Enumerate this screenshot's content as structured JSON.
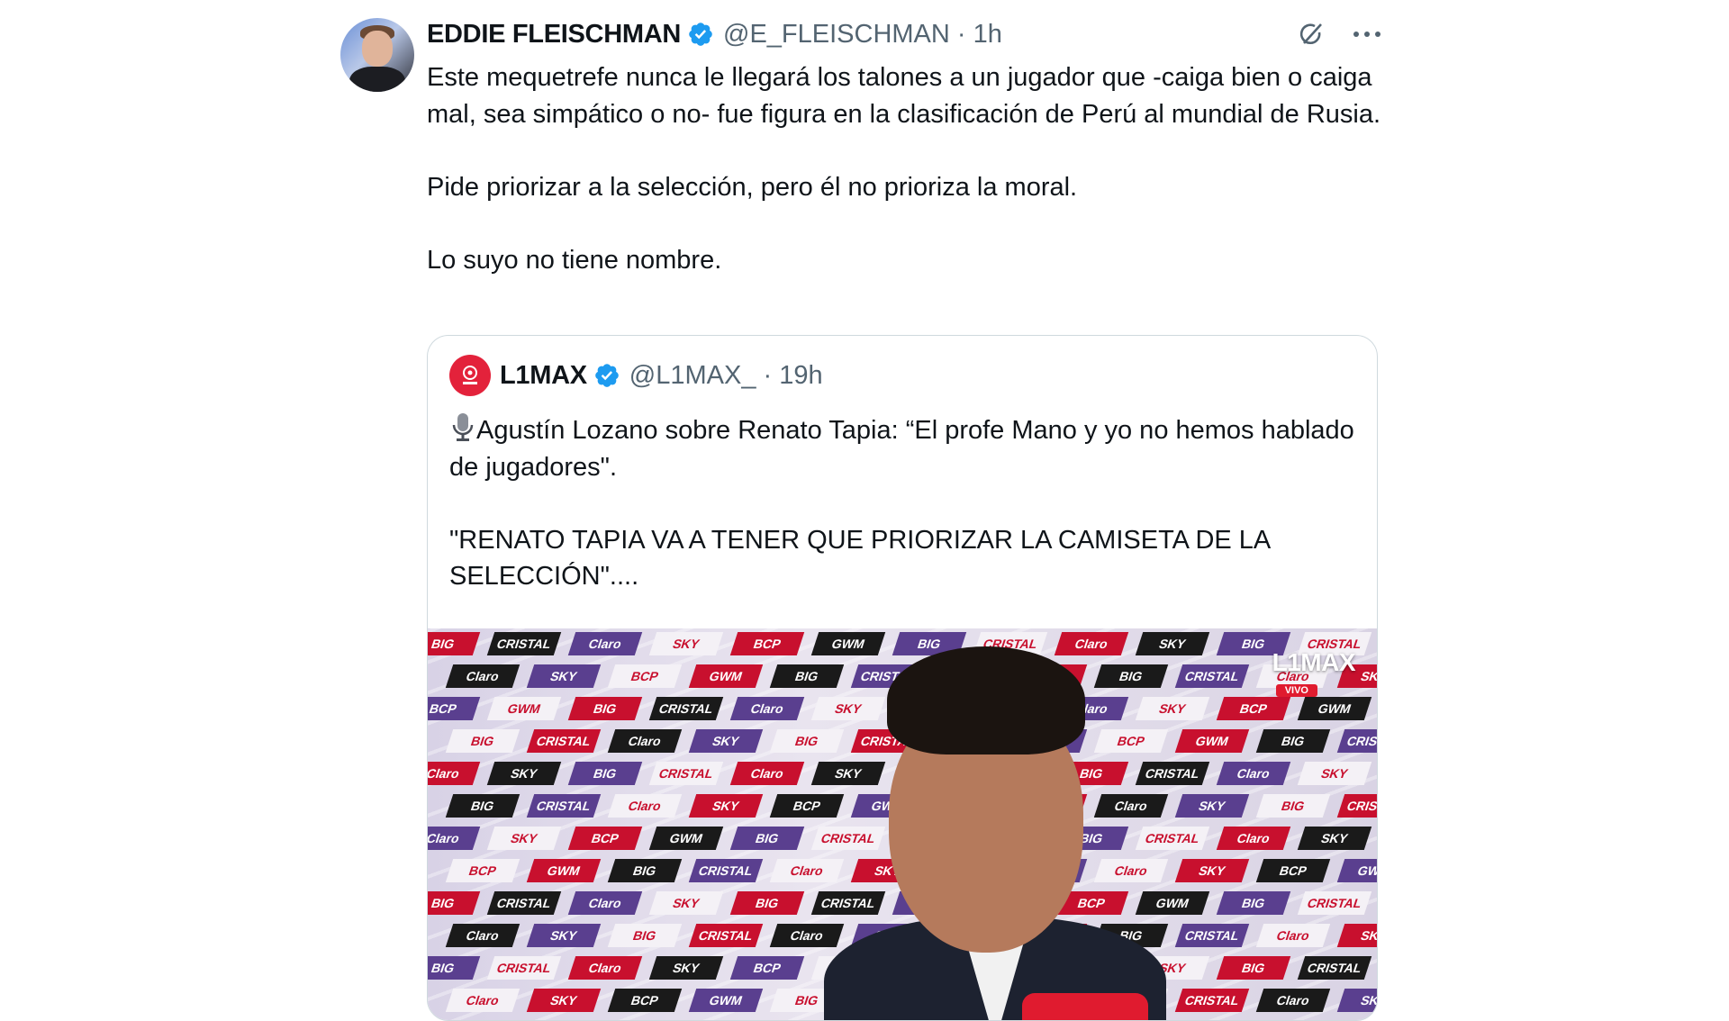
{
  "tweet": {
    "name": "EDDIE FLEISCHMAN",
    "handle": "@E_FLEISCHMAN · 1h",
    "text": "Este mequetrefe nunca le llegará los talones a un jugador que -caiga bien o caiga mal, sea simpático o no- fue figura en la clasificación de Perú al mundial de Rusia.\n\nPide priorizar a la selección, pero él no prioriza la moral.\n\nLo suyo no tiene nombre."
  },
  "quote": {
    "name": "L1MAX",
    "handle": "@L1MAX_ · 19h",
    "text": "Agustín Lozano sobre Renato Tapia: “El profe Mano y yo no hemos hablado de jugadores\".\n\n\"RENATO TAPIA VA A TENER QUE PRIORIZAR LA CAMISETA DE LA SELECCIÓN\"....",
    "media_logo": "L1MAX",
    "media_badge": "VIVO",
    "tiles": [
      "BIG",
      "CRISTAL",
      "Claro",
      "SKY",
      "BCP",
      "GWM",
      "BIG",
      "CRISTAL",
      "Claro",
      "SKY"
    ]
  },
  "colors": {
    "verified": "#1d9bf0",
    "secondary_text": "#536471",
    "border": "#cfd9de",
    "l1max_red": "#e3223b"
  },
  "icons": {
    "grok": "grok-icon",
    "more": "more-icon",
    "verified": "verified-badge-icon",
    "mic": "microphone-icon"
  }
}
